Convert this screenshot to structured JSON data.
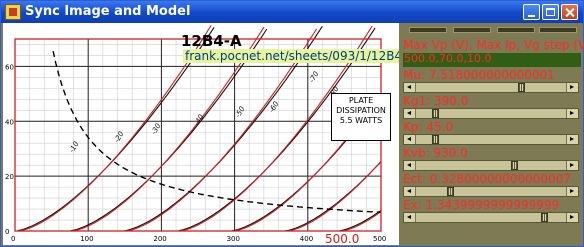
{
  "window": {
    "title": "Sync Image and Model"
  },
  "plot": {
    "datasheet_title": "12B4-A",
    "url": "frank.pocnet.net/sheets/093/1/12B4A.pdf",
    "plate_box": [
      "PLATE",
      "DISSIPATION",
      "5.5 WATTS"
    ],
    "x_max_label": "500.0",
    "x_ticks": [
      "0",
      "100",
      "200",
      "300",
      "400",
      "500"
    ],
    "y_ticks": [
      "0",
      "20",
      "40",
      "60"
    ],
    "curve_labels": [
      "-10",
      "-20",
      "-30",
      "-40",
      "-50",
      "-60",
      "-70",
      "-80"
    ]
  },
  "panel": {
    "max_label": "Max Vp (V), Max Ip, Vg step (V)",
    "max_value": "500.0,70.0,10.0",
    "params": [
      {
        "label": "Mu: 7.518000000000001",
        "fraction": 0.71
      },
      {
        "label": "Kg1: 390.0",
        "fraction": 0.12
      },
      {
        "label": "Kp: 45.0",
        "fraction": 0.12
      },
      {
        "label": "Kvb: 930.0",
        "fraction": 0.66
      },
      {
        "label": "Ect: 0.32800000000000007",
        "fraction": 0.22
      },
      {
        "label": "Ex: 1.3439999999999999",
        "fraction": 0.87
      }
    ]
  },
  "colors": {
    "titlebar": "#1248c6",
    "panel_bg": "#7e7a54",
    "label_red": "#ff2a2a",
    "model_curve": "#d02020"
  }
}
